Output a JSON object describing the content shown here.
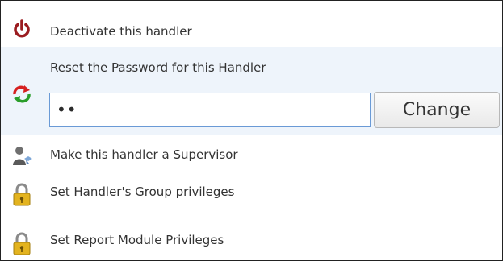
{
  "menu": {
    "deactivate": {
      "label": "Deactivate this handler",
      "icon": "power-icon"
    },
    "reset_password": {
      "label": "Reset the Password for this Handler",
      "icon": "refresh-icon",
      "password_value": "••",
      "change_label": "Change"
    },
    "supervisor": {
      "label": "Make this handler a Supervisor",
      "icon": "user-icon"
    },
    "group_privileges": {
      "label": "Set Handler's Group privileges",
      "icon": "lock-icon"
    },
    "report_privileges": {
      "label": "Set Report Module Privileges",
      "icon": "lock-icon"
    }
  },
  "colors": {
    "highlight_row": "#eef4fb",
    "input_border": "#6a9ad6",
    "power_icon": "#9b1c20"
  }
}
